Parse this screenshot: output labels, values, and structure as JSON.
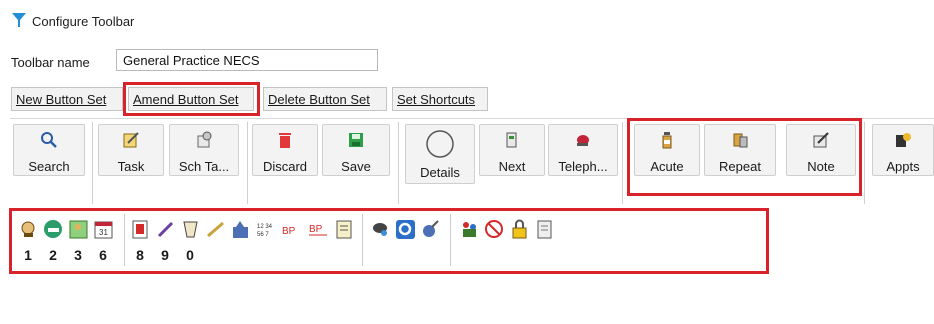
{
  "window": {
    "title": "Configure Toolbar"
  },
  "toolbar_name": {
    "label": "Toolbar name",
    "value": "General Practice NECS"
  },
  "set_buttons": [
    {
      "label": "New Button Set"
    },
    {
      "label": "Amend Button Set"
    },
    {
      "label": "Delete Button Set"
    },
    {
      "label": "Set Shortcuts"
    }
  ],
  "toolbar_buttons": [
    {
      "label": "Search",
      "icon": "magnifier-icon"
    },
    {
      "label": "Task",
      "icon": "task-icon"
    },
    {
      "label": "Sch Ta...",
      "icon": "scheduled-task-icon"
    },
    {
      "label": "Discard",
      "icon": "trash-icon"
    },
    {
      "label": "Save",
      "icon": "floppy-disk-icon"
    },
    {
      "label": "Details",
      "icon": "circle-icon"
    },
    {
      "label": "Next",
      "icon": "next-patient-icon"
    },
    {
      "label": "Teleph...",
      "icon": "telephone-icon"
    },
    {
      "label": "Acute",
      "icon": "medicine-bottle-icon"
    },
    {
      "label": "Repeat",
      "icon": "repeat-prescription-icon"
    },
    {
      "label": "Note",
      "icon": "note-pencil-icon"
    },
    {
      "label": "Appts",
      "icon": "appointments-icon"
    }
  ],
  "shortcut_icons": [
    {
      "icon": "consultation-icon",
      "shortcut": "1"
    },
    {
      "icon": "phone-icon",
      "shortcut": "2"
    },
    {
      "icon": "patient-card-icon",
      "shortcut": "3"
    },
    {
      "icon": "calendar-icon",
      "shortcut": "6"
    },
    {
      "icon": "report-icon",
      "shortcut": "8"
    },
    {
      "icon": "pen-icon",
      "shortcut": "9"
    },
    {
      "icon": "cup-icon",
      "shortcut": "0"
    },
    {
      "icon": "ruler-icon",
      "shortcut": ""
    },
    {
      "icon": "lab-icon",
      "shortcut": ""
    },
    {
      "icon": "numeric-icon",
      "shortcut": "",
      "text": "12 34\n56 7"
    },
    {
      "icon": "bp-icon",
      "shortcut": "",
      "text": "BP"
    },
    {
      "icon": "bp-chart-icon",
      "shortcut": "",
      "text": "BP"
    },
    {
      "icon": "document-list-icon",
      "shortcut": ""
    },
    {
      "icon": "weather-icon",
      "shortcut": ""
    },
    {
      "icon": "query-icon",
      "shortcut": ""
    },
    {
      "icon": "flask-icon",
      "shortcut": ""
    },
    {
      "icon": "people-icon",
      "shortcut": ""
    },
    {
      "icon": "no-smoking-icon",
      "shortcut": ""
    },
    {
      "icon": "padlock-icon",
      "shortcut": ""
    },
    {
      "icon": "page-icon",
      "shortcut": ""
    }
  ],
  "colors": {
    "highlight": "#d8232a",
    "button_bg": "#f3f3f3"
  }
}
